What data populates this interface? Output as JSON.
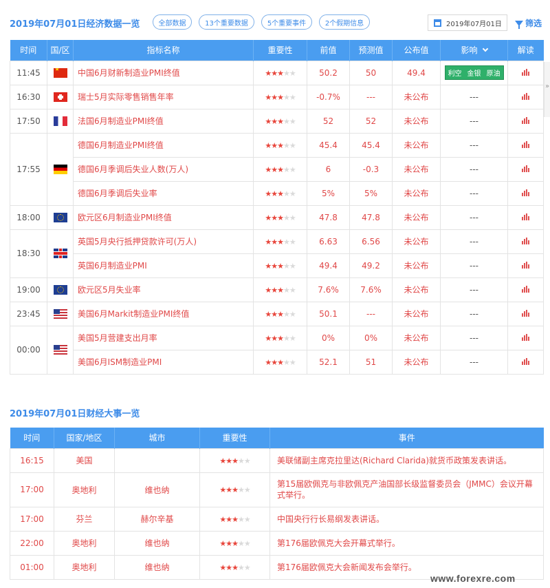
{
  "header": {
    "title": "2019年07月01日经济数据一览",
    "filters": [
      {
        "label": "全部数据"
      },
      {
        "label": "13个重要数据"
      },
      {
        "label": "5个重要事件"
      },
      {
        "label": "2个假期信息"
      }
    ],
    "date": "2019年07月01日",
    "filter_label": "筛选"
  },
  "econ_table": {
    "columns": [
      "时间",
      "国/区",
      "指标名称",
      "重要性",
      "前值",
      "预测值",
      "公布值",
      "影响",
      "解读"
    ],
    "rows": [
      {
        "time": "11:45",
        "flag": "cn",
        "flag_icon": "china-flag-icon",
        "name": "中国6月财新制造业PMI终值",
        "stars": 3,
        "prev": "50.2",
        "forecast": "50",
        "actual": "49.4",
        "impact_tags": [
          "利空",
          "金银",
          "原油"
        ]
      },
      {
        "time": "16:30",
        "flag": "ch",
        "flag_icon": "switzerland-flag-icon",
        "name": "瑞士5月实际零售销售年率",
        "stars": 3,
        "prev": "-0.7%",
        "forecast": "---",
        "actual": "未公布",
        "impact": "---"
      },
      {
        "time": "17:50",
        "flag": "fr",
        "flag_icon": "france-flag-icon",
        "name": "法国6月制造业PMI终值",
        "stars": 3,
        "prev": "52",
        "forecast": "52",
        "actual": "未公布",
        "impact": "---"
      },
      {
        "time": "17:55",
        "flag": "de",
        "flag_icon": "germany-flag-icon",
        "name": "德国6月制造业PMI终值",
        "stars": 3,
        "prev": "45.4",
        "forecast": "45.4",
        "actual": "未公布",
        "impact": "---"
      },
      {
        "time": "17:55",
        "flag": "de",
        "flag_icon": "germany-flag-icon",
        "name": "德国6月季调后失业人数(万人)",
        "stars": 3,
        "prev": "6",
        "forecast": "-0.3",
        "actual": "未公布",
        "impact": "---"
      },
      {
        "time": "17:55",
        "flag": "de",
        "flag_icon": "germany-flag-icon",
        "name": "德国6月季调后失业率",
        "stars": 3,
        "prev": "5%",
        "forecast": "5%",
        "actual": "未公布",
        "impact": "---"
      },
      {
        "time": "18:00",
        "flag": "eu",
        "flag_icon": "eu-flag-icon",
        "name": "欧元区6月制造业PMI终值",
        "stars": 3,
        "prev": "47.8",
        "forecast": "47.8",
        "actual": "未公布",
        "impact": "---"
      },
      {
        "time": "18:30",
        "flag": "uk",
        "flag_icon": "uk-flag-icon",
        "name": "英国5月央行抵押贷款许可(万人)",
        "stars": 3,
        "prev": "6.63",
        "forecast": "6.56",
        "actual": "未公布",
        "impact": "---"
      },
      {
        "time": "18:30",
        "flag": "uk",
        "flag_icon": "uk-flag-icon",
        "name": "英国6月制造业PMI",
        "stars": 3,
        "prev": "49.4",
        "forecast": "49.2",
        "actual": "未公布",
        "impact": "---"
      },
      {
        "time": "19:00",
        "flag": "eu",
        "flag_icon": "eu-flag-icon",
        "name": "欧元区5月失业率",
        "stars": 3,
        "prev": "7.6%",
        "forecast": "7.6%",
        "actual": "未公布",
        "impact": "---"
      },
      {
        "time": "23:45",
        "flag": "us",
        "flag_icon": "us-flag-icon",
        "name": "美国6月Markit制造业PMI终值",
        "stars": 3,
        "prev": "50.1",
        "forecast": "---",
        "actual": "未公布",
        "impact": "---"
      },
      {
        "time": "00:00",
        "flag": "us",
        "flag_icon": "us-flag-icon",
        "name": "美国5月营建支出月率",
        "stars": 3,
        "prev": "0%",
        "forecast": "0%",
        "actual": "未公布",
        "impact": "---"
      },
      {
        "time": "00:00",
        "flag": "us",
        "flag_icon": "us-flag-icon",
        "name": "美国6月ISM制造业PMI",
        "stars": 3,
        "prev": "52.1",
        "forecast": "51",
        "actual": "未公布",
        "impact": "---"
      }
    ]
  },
  "events": {
    "title": "2019年07月01日财经大事一览",
    "columns": [
      "时间",
      "国家/地区",
      "城市",
      "重要性",
      "事件"
    ],
    "rows": [
      {
        "time": "16:15",
        "country": "美国",
        "city": "",
        "stars": 3,
        "event": "美联储副主席克拉里达(Richard Clarida)就货币政策发表讲话。"
      },
      {
        "time": "17:00",
        "country": "奥地利",
        "city": "维也纳",
        "stars": 3,
        "event": "第15届欧佩克与非欧佩克产油国部长级监督委员会（JMMC）会议开幕式举行。"
      },
      {
        "time": "17:00",
        "country": "芬兰",
        "city": "赫尔辛基",
        "stars": 3,
        "event": "中国央行行长易纲发表讲话。"
      },
      {
        "time": "22:00",
        "country": "奥地利",
        "city": "维也纳",
        "stars": 3,
        "event": "第176届欧佩克大会开幕式举行。"
      },
      {
        "time": "01:00",
        "country": "奥地利",
        "city": "维也纳",
        "stars": 3,
        "event": "第176届欧佩克大会新闻发布会举行。"
      }
    ]
  },
  "watermark": "www.forexre.com",
  "colors": {
    "accent": "#3d8be8",
    "header_bg": "#4a9df0",
    "red": "#e04848",
    "green_tag": "#2fb06a"
  }
}
